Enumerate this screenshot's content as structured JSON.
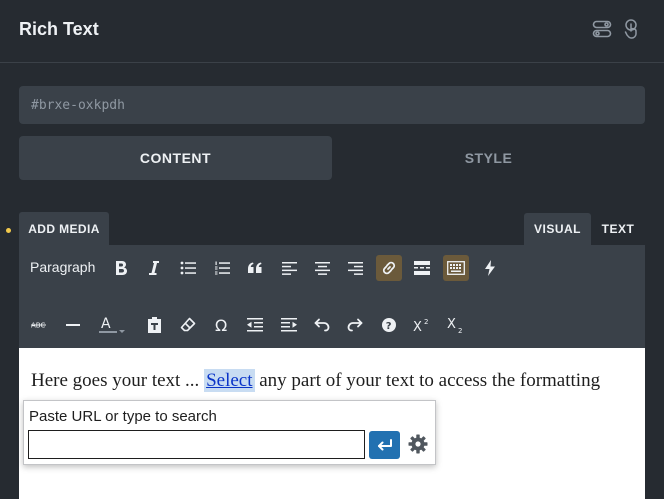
{
  "panel": {
    "title": "Rich Text",
    "header_icons": [
      "toggle-switch-icon",
      "pointer-hand-icon"
    ]
  },
  "element_id": {
    "value": "#brxe-oxkpdh"
  },
  "tabs": [
    {
      "label": "CONTENT",
      "active": true
    },
    {
      "label": "STYLE",
      "active": false
    }
  ],
  "editor": {
    "add_media_label": "ADD MEDIA",
    "modes": [
      {
        "label": "VISUAL",
        "active": true
      },
      {
        "label": "TEXT",
        "active": false
      }
    ],
    "format_select": "Paragraph",
    "toolbar_row1": [
      "bold-icon",
      "italic-icon",
      "bulleted-list-icon",
      "numbered-list-icon",
      "blockquote-icon",
      "align-left-icon",
      "align-center-icon",
      "align-right-icon",
      "link-icon",
      "read-more-icon",
      "toolbar-toggle-icon",
      "lightning-icon"
    ],
    "toolbar_row2": [
      "strikethrough-icon",
      "horizontal-line-icon",
      "text-color-icon",
      "paste-text-icon",
      "clear-formatting-icon",
      "special-character-icon",
      "outdent-icon",
      "indent-icon",
      "undo-icon",
      "redo-icon",
      "help-icon",
      "superscript-icon",
      "subscript-icon"
    ],
    "active_buttons": [
      "link-icon",
      "toolbar-toggle-icon"
    ],
    "content": {
      "before": "Here goes your text ... ",
      "selected": "Select",
      "after": " any part of your text to access the formatting"
    }
  },
  "link_popup": {
    "label": "Paste URL or type to search",
    "input_value": ""
  },
  "colors": {
    "background": "#262b31",
    "control": "#3a4149",
    "active_button": "#6b5a3b",
    "accent_dot": "#f2c94c",
    "apply_button": "#2271b1",
    "link": "#0a34c8"
  }
}
